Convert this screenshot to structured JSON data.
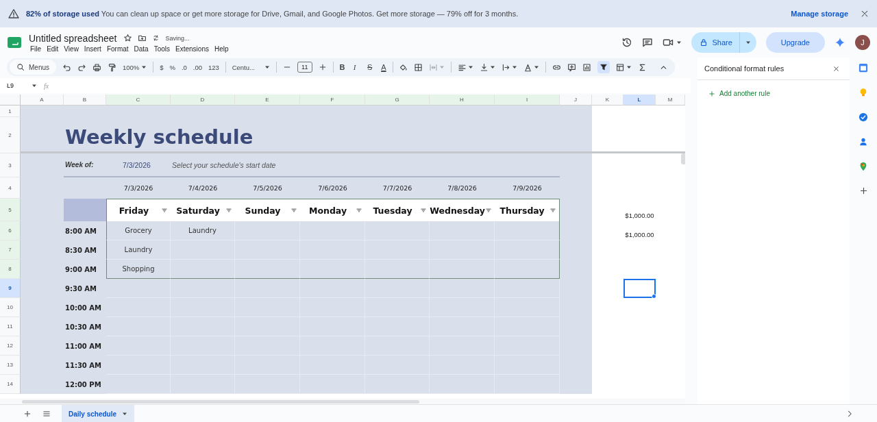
{
  "banner": {
    "message": "**82% of storage used** You can clean up space or get more storage for Drive, Gmail, and Google Photos. Get more storage — 79% off for 3 months.",
    "action": "Manage storage"
  },
  "document": {
    "title": "Untitled spreadsheet",
    "status": "Saving..."
  },
  "menus": [
    "File",
    "Edit",
    "View",
    "Insert",
    "Format",
    "Data",
    "Tools",
    "Extensions",
    "Help"
  ],
  "header": {
    "share": "Share",
    "upgrade": "Upgrade",
    "avatar": "J"
  },
  "toolbar": {
    "search": "Menus",
    "zoom": "100%",
    "currency": "$",
    "percent": "%",
    "decrease_decimals": ".0",
    "increase_decimals": ".00",
    "number_format": "123",
    "font": "Centu...",
    "font_size": "11",
    "bold": "B",
    "italic": "I",
    "strikethrough": "S",
    "text_color": "A",
    "filter_on": true
  },
  "formula_bar": {
    "name_box": "L9",
    "fx": "fx"
  },
  "columns": [
    {
      "label": "A",
      "filtered": false,
      "selected": false
    },
    {
      "label": "B",
      "filtered": false,
      "selected": false
    },
    {
      "label": "C",
      "filtered": true,
      "selected": false
    },
    {
      "label": "D",
      "filtered": true,
      "selected": false
    },
    {
      "label": "E",
      "filtered": true,
      "selected": false
    },
    {
      "label": "F",
      "filtered": true,
      "selected": false
    },
    {
      "label": "G",
      "filtered": true,
      "selected": false
    },
    {
      "label": "H",
      "filtered": true,
      "selected": false
    },
    {
      "label": "I",
      "filtered": true,
      "selected": false
    },
    {
      "label": "J",
      "filtered": false,
      "selected": false
    },
    {
      "label": "K",
      "filtered": false,
      "selected": false
    },
    {
      "label": "L",
      "filtered": false,
      "selected": true
    },
    {
      "label": "M",
      "filtered": false,
      "selected": false
    }
  ],
  "rows": [
    {
      "label": "1",
      "filtered": false,
      "selected": false
    },
    {
      "label": "2",
      "filtered": false,
      "selected": false
    },
    {
      "label": "3",
      "filtered": false,
      "selected": false
    },
    {
      "label": "4",
      "filtered": false,
      "selected": false
    },
    {
      "label": "5",
      "filtered": true,
      "selected": false
    },
    {
      "label": "6",
      "filtered": true,
      "selected": false
    },
    {
      "label": "7",
      "filtered": true,
      "selected": false
    },
    {
      "label": "8",
      "filtered": true,
      "selected": false
    },
    {
      "label": "9",
      "filtered": false,
      "selected": true
    },
    {
      "label": "10",
      "filtered": false,
      "selected": false
    },
    {
      "label": "11",
      "filtered": false,
      "selected": false
    },
    {
      "label": "12",
      "filtered": false,
      "selected": false
    },
    {
      "label": "13",
      "filtered": false,
      "selected": false
    },
    {
      "label": "14",
      "filtered": false,
      "selected": false
    }
  ],
  "schedule": {
    "title": "Weekly schedule",
    "week_label": "Week of:",
    "week_date": "7/3/2026",
    "hint": "Select your schedule's start date",
    "dates": [
      "7/3/2026",
      "7/4/2026",
      "7/5/2026",
      "7/6/2026",
      "7/7/2026",
      "7/8/2026",
      "7/9/2026"
    ],
    "days": [
      "Friday",
      "Saturday",
      "Sunday",
      "Monday",
      "Tuesday",
      "Wednesday",
      "Thursday"
    ],
    "slots": [
      {
        "time": "8:00 AM",
        "entries": [
          "Grocery",
          "Laundry"
        ]
      },
      {
        "time": "8:30 AM",
        "entries": [
          "Laundry"
        ]
      },
      {
        "time": "9:00 AM",
        "entries": [
          "Shopping"
        ]
      },
      {
        "time": "9:30 AM"
      },
      {
        "time": "10:00 AM"
      },
      {
        "time": "10:30 AM"
      },
      {
        "time": "11:00 AM"
      },
      {
        "time": "11:30 AM"
      },
      {
        "time": "12:00 PM"
      }
    ]
  },
  "side_values": [
    "$1,000.00",
    "$1,000.00"
  ],
  "panel": {
    "title": "Conditional format rules",
    "action": "Add another rule"
  },
  "sheets": [
    {
      "name": "Daily schedule",
      "selected": true
    }
  ]
}
